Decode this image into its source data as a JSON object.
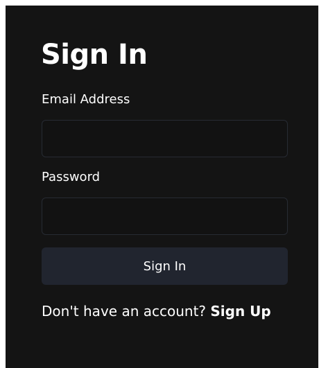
{
  "form": {
    "title": "Sign In",
    "email_label": "Email Address",
    "email_value": "",
    "email_placeholder": "",
    "password_label": "Password",
    "password_value": "",
    "password_placeholder": "",
    "submit_label": "Sign In",
    "no_account_text": "Don't have an account? ",
    "signup_link_label": "Sign Up"
  },
  "colors": {
    "page_background": "#ffffff",
    "card_background": "#141414",
    "input_border": "#272b33",
    "button_background": "#21252f",
    "text": "#ffffff"
  }
}
